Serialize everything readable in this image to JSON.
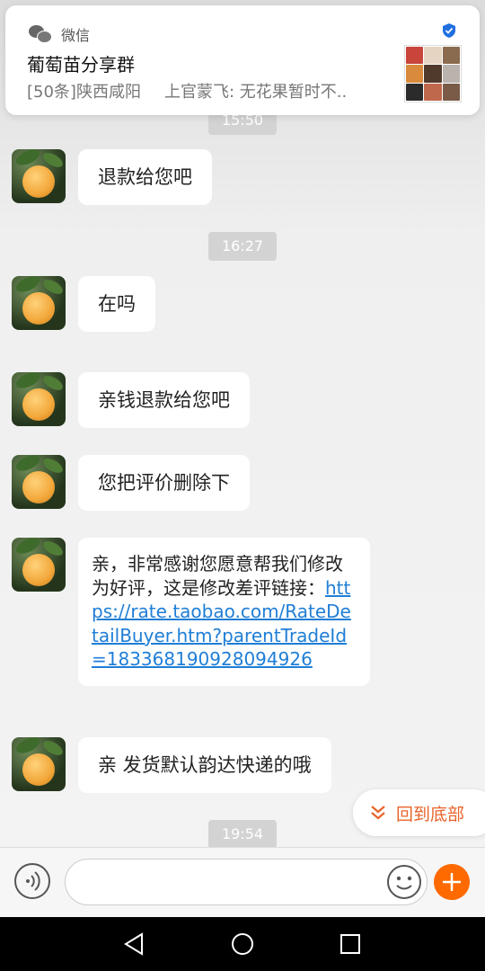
{
  "notification": {
    "app_name": "微信",
    "title": "葡萄苗分享群",
    "message_prefix": "[50条]陕西咸阳",
    "message_body": "上官蒙飞: 无花果暂时不.."
  },
  "timestamps": [
    "15:50",
    "16:27",
    "19:54"
  ],
  "messages": [
    {
      "text": "退款给您吧"
    },
    {
      "text": "在吗"
    },
    {
      "text": "亲钱退款给您吧"
    },
    {
      "text": "您把评价删除下"
    },
    {
      "text": "亲，非常感谢您愿意帮我们修改为好评，这是修改差评链接：",
      "link": "https://rate.taobao.com/RateDetailBuyer.htm?parentTradeId=183368190928094926"
    },
    {
      "text": "亲 发货默认韵达快递的哦"
    }
  ],
  "back_to_bottom_label": "回到底部",
  "input": {
    "placeholder": ""
  },
  "icons": {
    "voice": "voice-icon",
    "emoji": "emoji-icon",
    "plus": "plus-icon",
    "back": "back-nav-icon",
    "home": "home-nav-icon",
    "recents": "recents-nav-icon"
  },
  "colors": {
    "accent_orange": "#ff6a00",
    "link_blue": "#1f7ed6"
  }
}
